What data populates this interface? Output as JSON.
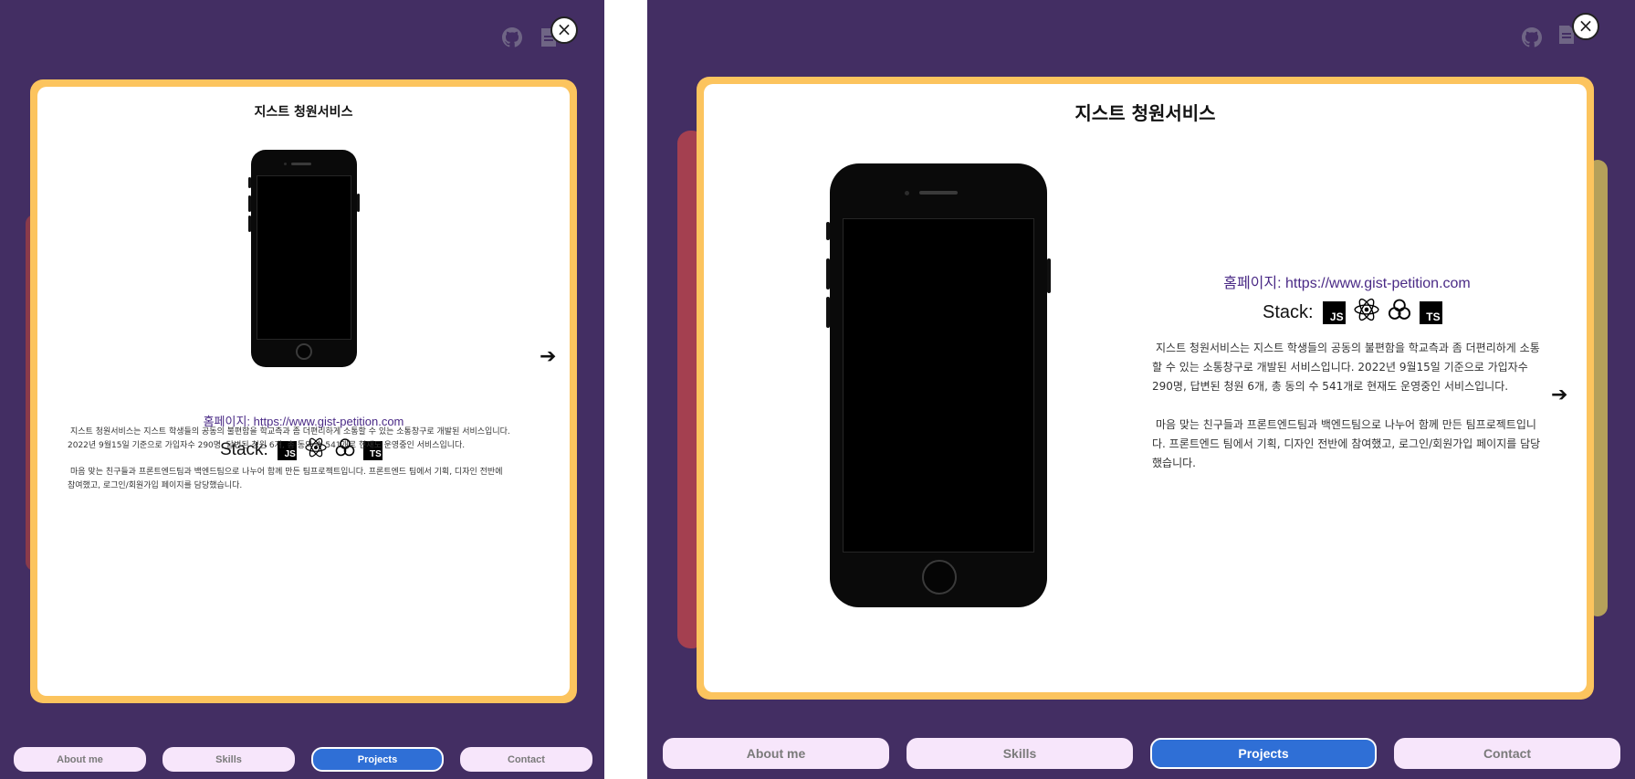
{
  "colors": {
    "background": "#432e63",
    "card_frame": "#fcc45e",
    "card": "#ffffff",
    "nav_active": "#2f6fd6",
    "nav_inactive": "#f7e6fb",
    "link_text": "#4a2a86"
  },
  "top_icons": {
    "github": "github-icon",
    "document": "document-icon",
    "close_label": "×"
  },
  "project": {
    "title": "지스트 청원서비스",
    "homepage_label": "홈페이지: https://www.gist-petition.com",
    "stack_label": "Stack:",
    "stack_badges": {
      "js": "JS",
      "ts": "TS"
    },
    "stack_icons": [
      "javascript-icon",
      "react-icon",
      "graphql-icon",
      "typescript-icon"
    ],
    "description_1": "지스트 청원서비스는 지스트 학생들의 공동의 불편함을 학교측과 좀 더편리하게 소통할 수 있는 소통창구로 개발된 서비스입니다. 2022년 9월15일 기준으로 가입자수 290명, 답변된 청원 6개, 총 동의 수 541개로 현재도 운영중인 서비스입니다.",
    "description_2": "마음 맞는 친구들과 프론트엔드팀과 백엔드팀으로 나누어 함께 만든 팀프로젝트입니다. 프론트엔드 팀에서 기획, 디자인 전반에 참여했고, 로그인/회원가입 페이지를 담당했습니다.",
    "next_arrow": "➔"
  },
  "nav": {
    "about": "About me",
    "skills": "Skills",
    "projects": "Projects",
    "contact": "Contact",
    "active": "Projects"
  }
}
